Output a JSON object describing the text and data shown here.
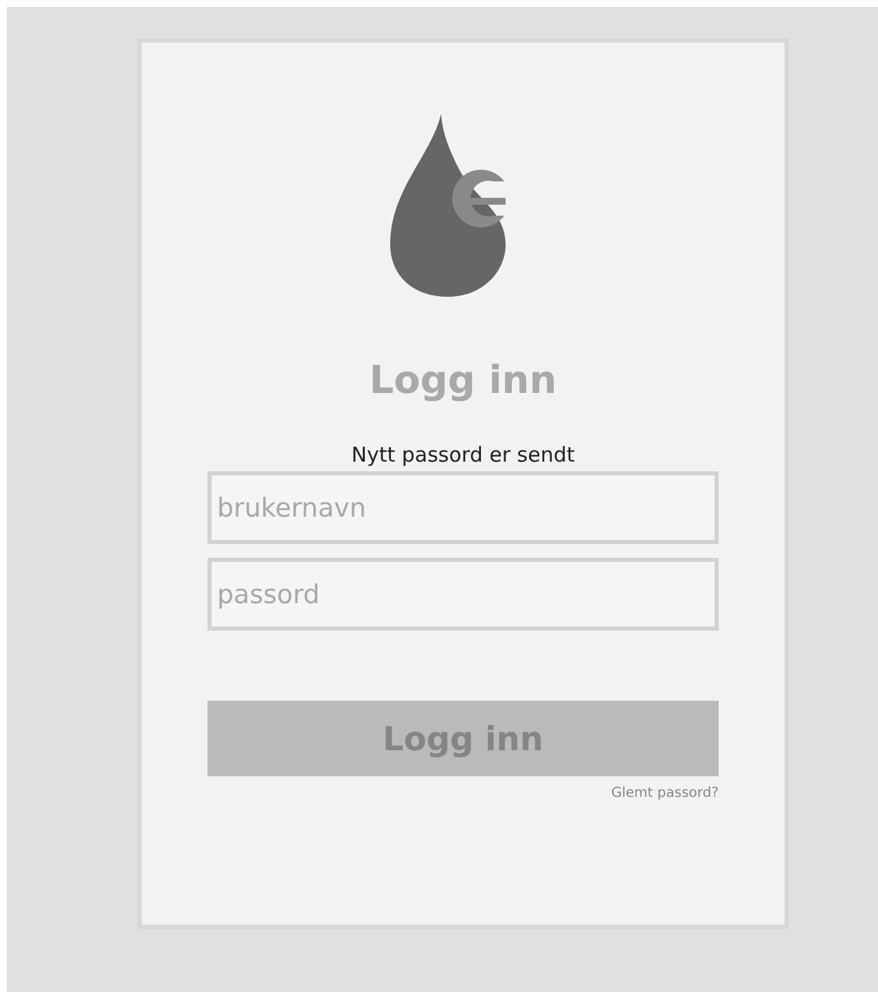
{
  "title": "Logg inn",
  "message": "Nytt passord er sendt",
  "fields": [
    {
      "placeholder": "brukernavn"
    },
    {
      "placeholder": "passord"
    }
  ],
  "submit": {
    "label": "Logg inn",
    "disabled": true
  },
  "forgot_link": "Glemt passord?"
}
